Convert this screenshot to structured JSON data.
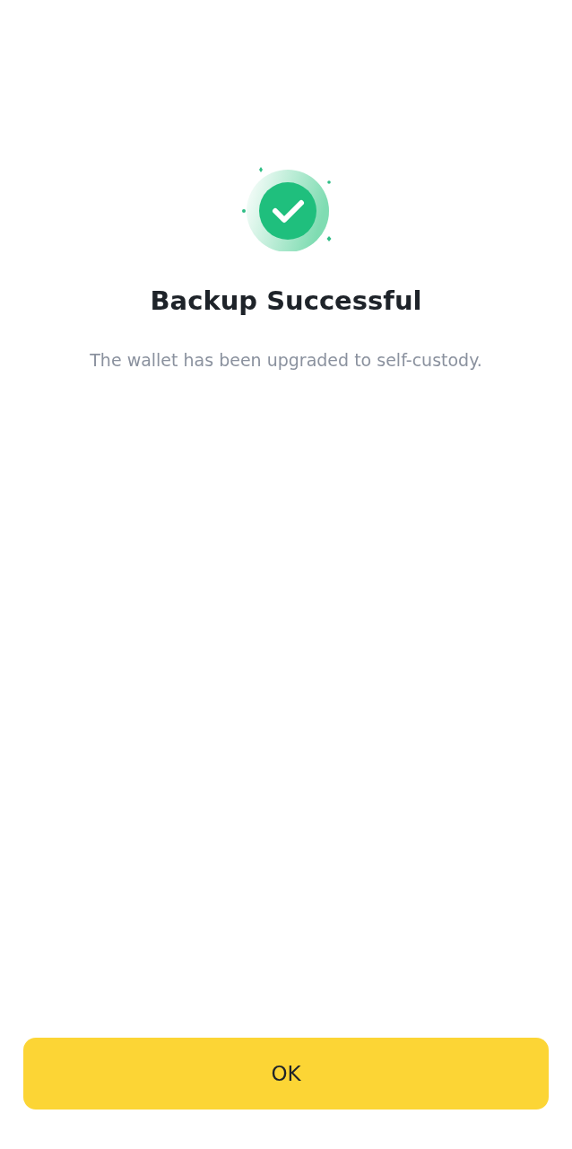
{
  "title": "Backup Successful",
  "message": "The wallet has been upgraded to self-custody.",
  "button": {
    "label": "OK"
  }
}
